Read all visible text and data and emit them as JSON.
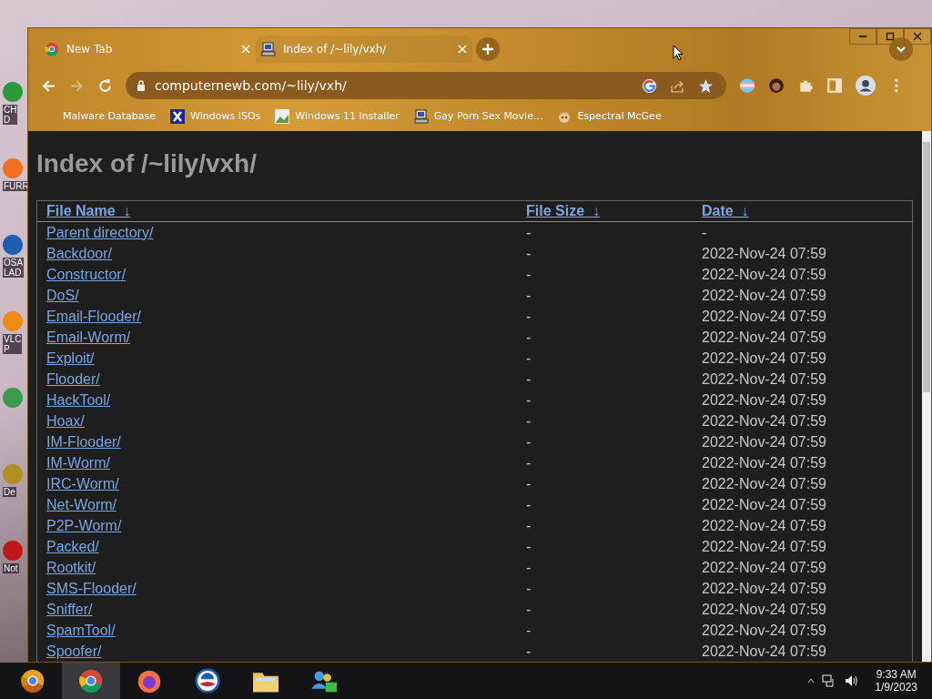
{
  "desktop": {
    "icons": [
      {
        "label": "CH\nD",
        "kind": "chrome"
      },
      {
        "label": "FURR",
        "kind": "orange"
      },
      {
        "label": "OSA\nLAD",
        "kind": "obama"
      },
      {
        "label": "VLC\nP",
        "kind": "cone"
      },
      {
        "kind": "h"
      },
      {
        "label": "De",
        "kind": "gold"
      },
      {
        "label": "Not",
        "kind": "red"
      }
    ]
  },
  "tabs": [
    {
      "title": "New Tab",
      "kind": "chrome",
      "selected": false
    },
    {
      "title": "Index of /~lily/vxh/",
      "kind": "computer",
      "selected": true
    }
  ],
  "address_bar": {
    "url": "computernewb.com/~lily/vxh/"
  },
  "bookmarks": [
    {
      "label": "Malware Database",
      "kind": "plain"
    },
    {
      "label": "Windows ISOs",
      "kind": "x-logo"
    },
    {
      "label": "Windows 11 Installer",
      "kind": "picture"
    },
    {
      "label": "Gay Porn Sex Movie...",
      "kind": "computer"
    },
    {
      "label": "Espectral McGee",
      "kind": "face"
    }
  ],
  "page": {
    "heading": "Index of /~lily/vxh/",
    "columns": [
      {
        "label": "File Name",
        "sort": "↓"
      },
      {
        "label": "File Size",
        "sort": "↓"
      },
      {
        "label": "Date",
        "sort": "↓"
      }
    ],
    "rows": [
      {
        "name": "Parent directory/",
        "size": "-",
        "date": "-"
      },
      {
        "name": "Backdoor/",
        "size": "-",
        "date": "2022-Nov-24 07:59"
      },
      {
        "name": "Constructor/",
        "size": "-",
        "date": "2022-Nov-24 07:59"
      },
      {
        "name": "DoS/",
        "size": "-",
        "date": "2022-Nov-24 07:59"
      },
      {
        "name": "Email-Flooder/",
        "size": "-",
        "date": "2022-Nov-24 07:59"
      },
      {
        "name": "Email-Worm/",
        "size": "-",
        "date": "2022-Nov-24 07:59"
      },
      {
        "name": "Exploit/",
        "size": "-",
        "date": "2022-Nov-24 07:59"
      },
      {
        "name": "Flooder/",
        "size": "-",
        "date": "2022-Nov-24 07:59"
      },
      {
        "name": "HackTool/",
        "size": "-",
        "date": "2022-Nov-24 07:59"
      },
      {
        "name": "Hoax/",
        "size": "-",
        "date": "2022-Nov-24 07:59"
      },
      {
        "name": "IM-Flooder/",
        "size": "-",
        "date": "2022-Nov-24 07:59"
      },
      {
        "name": "IM-Worm/",
        "size": "-",
        "date": "2022-Nov-24 07:59"
      },
      {
        "name": "IRC-Worm/",
        "size": "-",
        "date": "2022-Nov-24 07:59"
      },
      {
        "name": "Net-Worm/",
        "size": "-",
        "date": "2022-Nov-24 07:59"
      },
      {
        "name": "P2P-Worm/",
        "size": "-",
        "date": "2022-Nov-24 07:59"
      },
      {
        "name": "Packed/",
        "size": "-",
        "date": "2022-Nov-24 07:59"
      },
      {
        "name": "Rootkit/",
        "size": "-",
        "date": "2022-Nov-24 07:59"
      },
      {
        "name": "SMS-Flooder/",
        "size": "-",
        "date": "2022-Nov-24 07:59"
      },
      {
        "name": "Sniffer/",
        "size": "-",
        "date": "2022-Nov-24 07:59"
      },
      {
        "name": "SpamTool/",
        "size": "-",
        "date": "2022-Nov-24 07:59"
      },
      {
        "name": "Spoofer/",
        "size": "-",
        "date": "2022-Nov-24 07:59"
      }
    ]
  },
  "taskbar": {
    "apps": [
      {
        "kind": "chrome-canary"
      },
      {
        "kind": "chrome",
        "selected": true
      },
      {
        "kind": "firefox",
        "selected": false
      },
      {
        "kind": "obama",
        "selected": false
      },
      {
        "kind": "folder",
        "selected": false
      },
      {
        "kind": "people",
        "selected": false
      }
    ],
    "time": "9:33 AM",
    "date": "1/9/2023"
  }
}
